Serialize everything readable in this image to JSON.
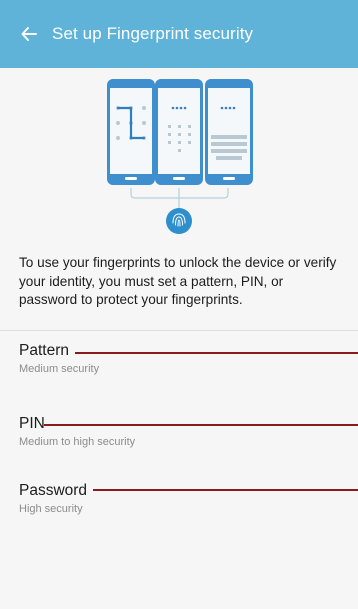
{
  "appbar": {
    "title": "Set up Fingerprint security",
    "back_icon": "arrow-left-icon"
  },
  "colors": {
    "appbar": "#5fb3d9",
    "accent": "#2d8fcc",
    "callout": "#8b1a1a"
  },
  "illustration": {
    "phone_icons": [
      "pattern-phone-icon",
      "pin-phone-icon",
      "password-phone-icon"
    ],
    "fingerprint_icon": "fingerprint-icon"
  },
  "intro_text": "To use your fingerprints to unlock the device or verify your identity, you must set a pattern, PIN, or password to protect your fingerprints.",
  "options": [
    {
      "title": "Pattern",
      "subtitle": "Medium security"
    },
    {
      "title": "PIN",
      "subtitle": "Medium to high security"
    },
    {
      "title": "Password",
      "subtitle": "High security"
    }
  ]
}
